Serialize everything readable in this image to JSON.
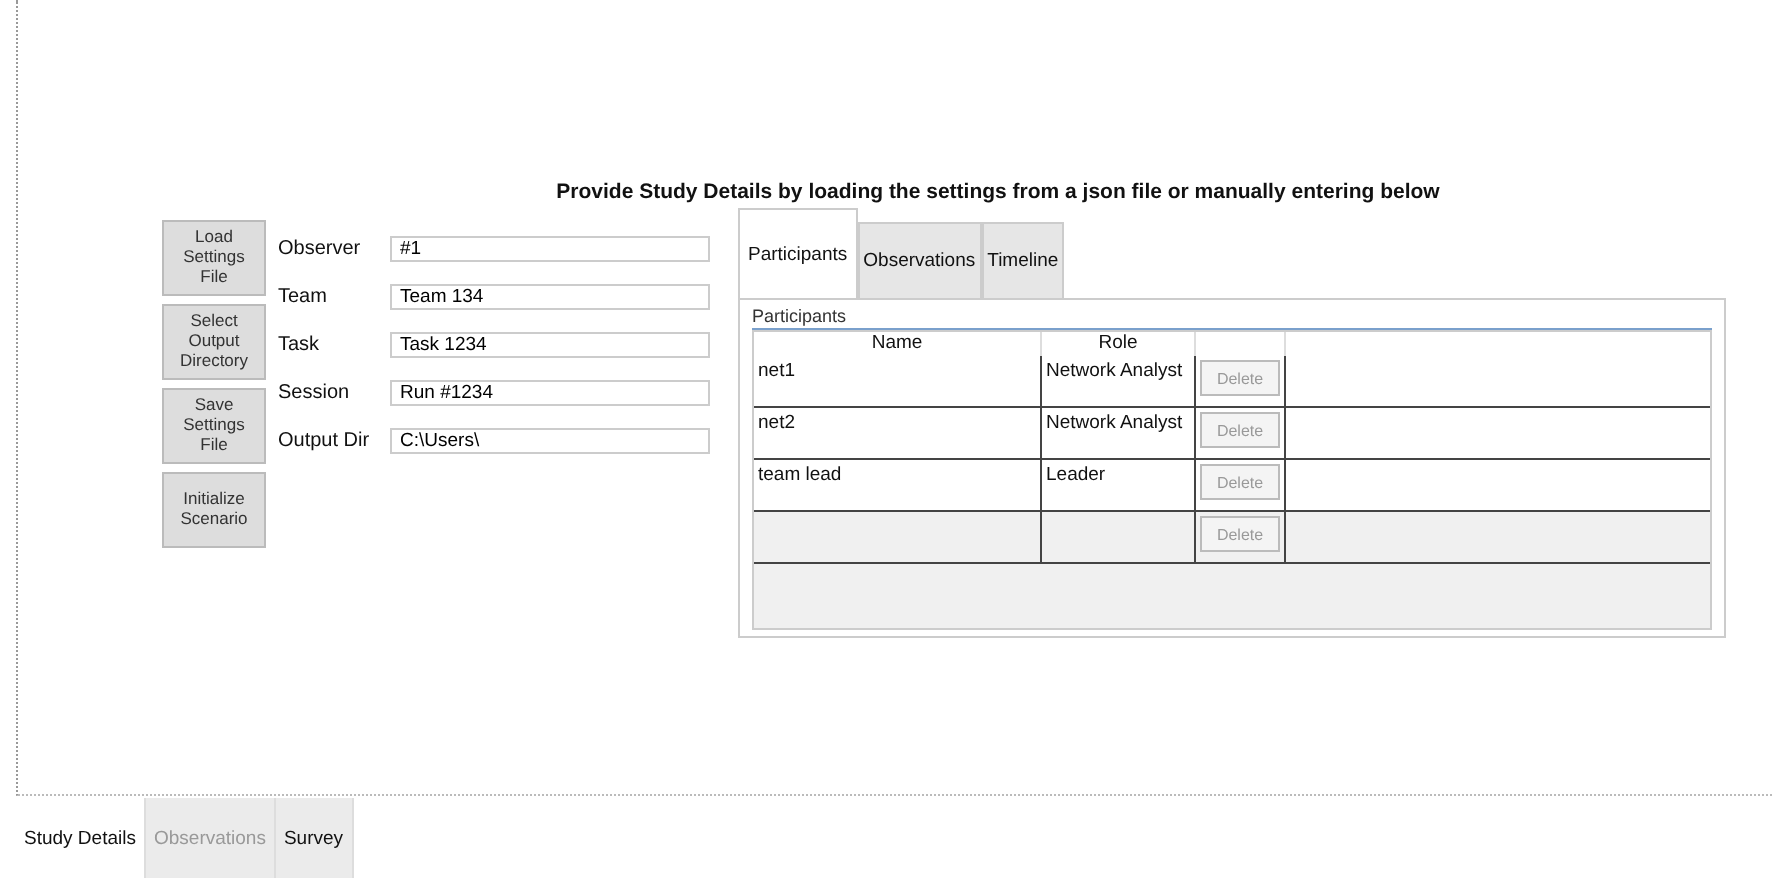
{
  "heading": "Provide Study Details by loading the settings from a json file or manually entering below",
  "actions": [
    "Load Settings File",
    "Select Output Directory",
    "Save Settings File",
    "Initialize Scenario"
  ],
  "fields": [
    {
      "label": "Observer",
      "value": "#1"
    },
    {
      "label": "Team",
      "value": "Team 134"
    },
    {
      "label": "Task",
      "value": "Task 1234"
    },
    {
      "label": "Session",
      "value": "Run #1234"
    },
    {
      "label": "Output Dir",
      "value": "C:\\Users\\"
    }
  ],
  "inner_tabs": [
    {
      "label": "Participants",
      "selected": true
    },
    {
      "label": "Observations",
      "selected": false
    },
    {
      "label": "Timeline",
      "selected": false
    }
  ],
  "participants": {
    "group_label": "Participants",
    "columns": [
      "Name",
      "Role"
    ],
    "rows": [
      {
        "kind": "entry",
        "name": "net1",
        "role": "Network Analyst",
        "action": "Delete",
        "disabled": true
      },
      {
        "kind": "entry",
        "name": "net2",
        "role": "Network Analyst",
        "action": "Delete",
        "disabled": true
      },
      {
        "kind": "entry",
        "name": "team lead",
        "role": "Leader",
        "action": "Delete",
        "disabled": true
      },
      {
        "kind": "new",
        "name": "",
        "role": "",
        "action": "Delete",
        "disabled": true
      }
    ]
  },
  "bottom_tabs": [
    {
      "label": "Study Details",
      "selected": true,
      "disabled": false
    },
    {
      "label": "Observations",
      "selected": false,
      "disabled": true
    },
    {
      "label": "Survey",
      "selected": false,
      "disabled": false
    }
  ]
}
